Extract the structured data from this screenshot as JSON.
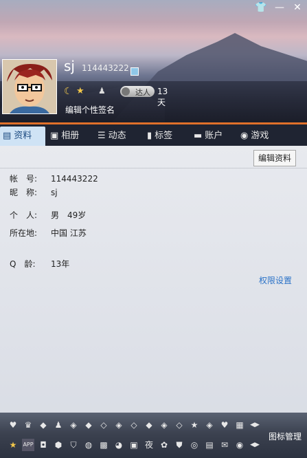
{
  "profile": {
    "nickname": "sj",
    "qq_number": "114443222",
    "talent_label": "达人",
    "days": "13天",
    "edit_signature": "编辑个性签名"
  },
  "tabs": [
    {
      "label": "资料",
      "icon": "id-card-icon",
      "active": true
    },
    {
      "label": "相册",
      "icon": "photo-album-icon",
      "active": false
    },
    {
      "label": "动态",
      "icon": "feed-list-icon",
      "active": false
    },
    {
      "label": "标签",
      "icon": "bookmark-icon",
      "active": false
    },
    {
      "label": "账户",
      "icon": "briefcase-icon",
      "active": false
    },
    {
      "label": "游戏",
      "icon": "game-icon",
      "active": false
    }
  ],
  "toolbar": {
    "edit_label": "编辑资料"
  },
  "info": {
    "account_label": "帐　号:",
    "account_value": "114443222",
    "nickname_label": "昵　称:",
    "nickname_value": "sj",
    "personal_label": "个　人:",
    "personal_value": "男　49岁",
    "location_label": "所在地:",
    "location_value": "中国 江苏",
    "qage_label": "Q　龄:",
    "qage_value": "13年"
  },
  "permission_link": "权限设置",
  "icon_manager": "图标管理",
  "colors": {
    "accent": "#e0702a",
    "link": "#2a72c7",
    "active_tab": "#cfe3f5"
  }
}
